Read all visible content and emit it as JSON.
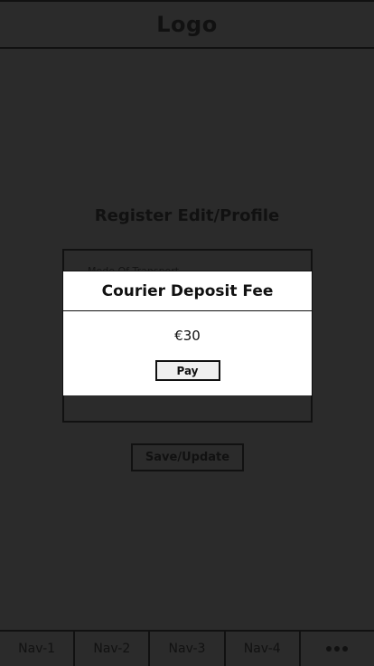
{
  "header": {
    "logo_text": "Logo"
  },
  "page": {
    "title": "Register Edit/Profile",
    "form_label": "Mode Of Transport"
  },
  "actions": {
    "save_label": "Save/Update"
  },
  "modal": {
    "title": "Courier Deposit Fee",
    "amount": "€30",
    "pay_label": "Pay"
  },
  "bottom_nav": {
    "items": [
      {
        "label": "Nav-1"
      },
      {
        "label": "Nav-2"
      },
      {
        "label": "Nav-3"
      },
      {
        "label": "Nav-4"
      }
    ],
    "more_icon": "more-horizontal-icon"
  }
}
